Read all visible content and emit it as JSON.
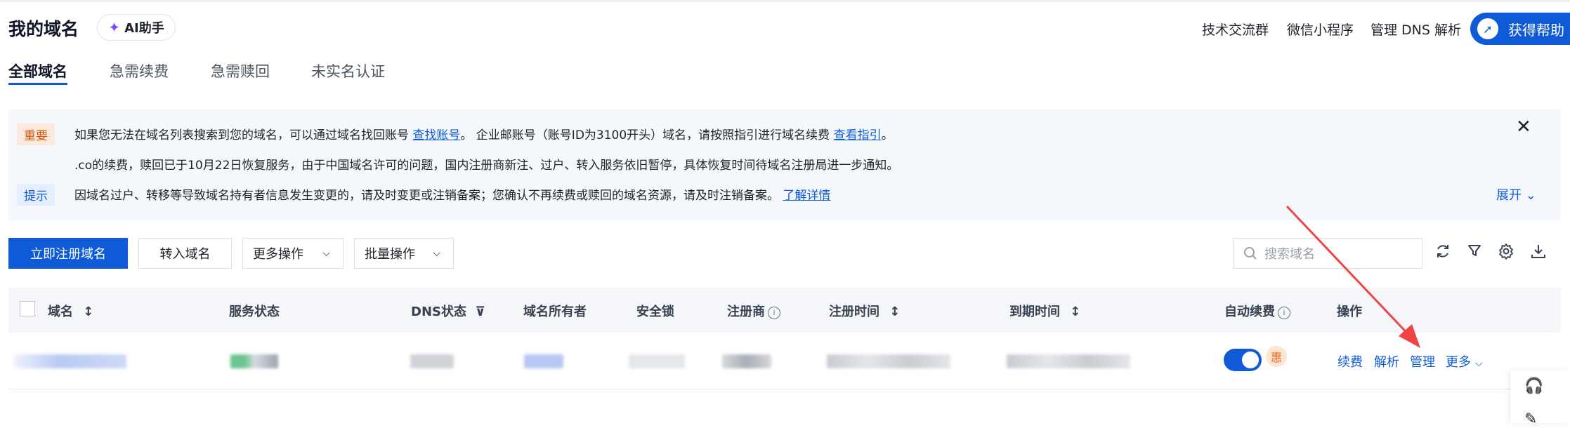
{
  "header": {
    "title": "我的域名",
    "ai_button": "AI助手",
    "links": [
      "技术交流群",
      "微信小程序",
      "管理 DNS 解析"
    ],
    "help_button": "获得帮助"
  },
  "tabs": [
    "全部域名",
    "急需续费",
    "急需赎回",
    "未实名认证"
  ],
  "notice": {
    "badge_important": "重要",
    "line1_pre": "如果您无法在域名列表搜索到您的域名，可以通过域名找回账号",
    "line1_link1": "查找账号",
    "line1_mid": "。 企业邮账号（账号ID为3100开头）域名，请按照指引进行域名续费",
    "line1_link2": "查看指引",
    "line1_end": "。",
    "line2": ".co的续费，赎回已于10月22日恢复服务，由于中国域名许可的问题，国内注册商新注、过户、转入服务依旧暂停，具体恢复时间待域名注册局进一步通知。",
    "badge_tip": "提示",
    "line3_pre": "因域名过户、转移等导致域名持有者信息发生变更的，请及时变更或注销备案；您确认不再续费或赎回的域名资源，请及时注销备案。",
    "line3_link": "了解详情",
    "expand": "展开"
  },
  "toolbar": {
    "register": "立即注册域名",
    "transfer": "转入域名",
    "more_ops": "更多操作",
    "batch_ops": "批量操作",
    "search_placeholder": "搜索域名"
  },
  "table": {
    "headers": {
      "domain": "域名",
      "service_status": "服务状态",
      "dns_status": "DNS状态",
      "owner": "域名所有者",
      "lock": "安全锁",
      "registrar": "注册商",
      "reg_time": "注册时间",
      "exp_time": "到期时间",
      "auto_renew": "自动续费",
      "actions": "操作"
    },
    "row": {
      "promo_badge": "惠",
      "actions": [
        "续费",
        "解析",
        "管理",
        "更多"
      ]
    }
  },
  "colors": {
    "primary": "#0f5bd7",
    "arrow": "#ef4444",
    "important_bg": "#fde9dc",
    "tip_bg": "#e5eeff"
  }
}
